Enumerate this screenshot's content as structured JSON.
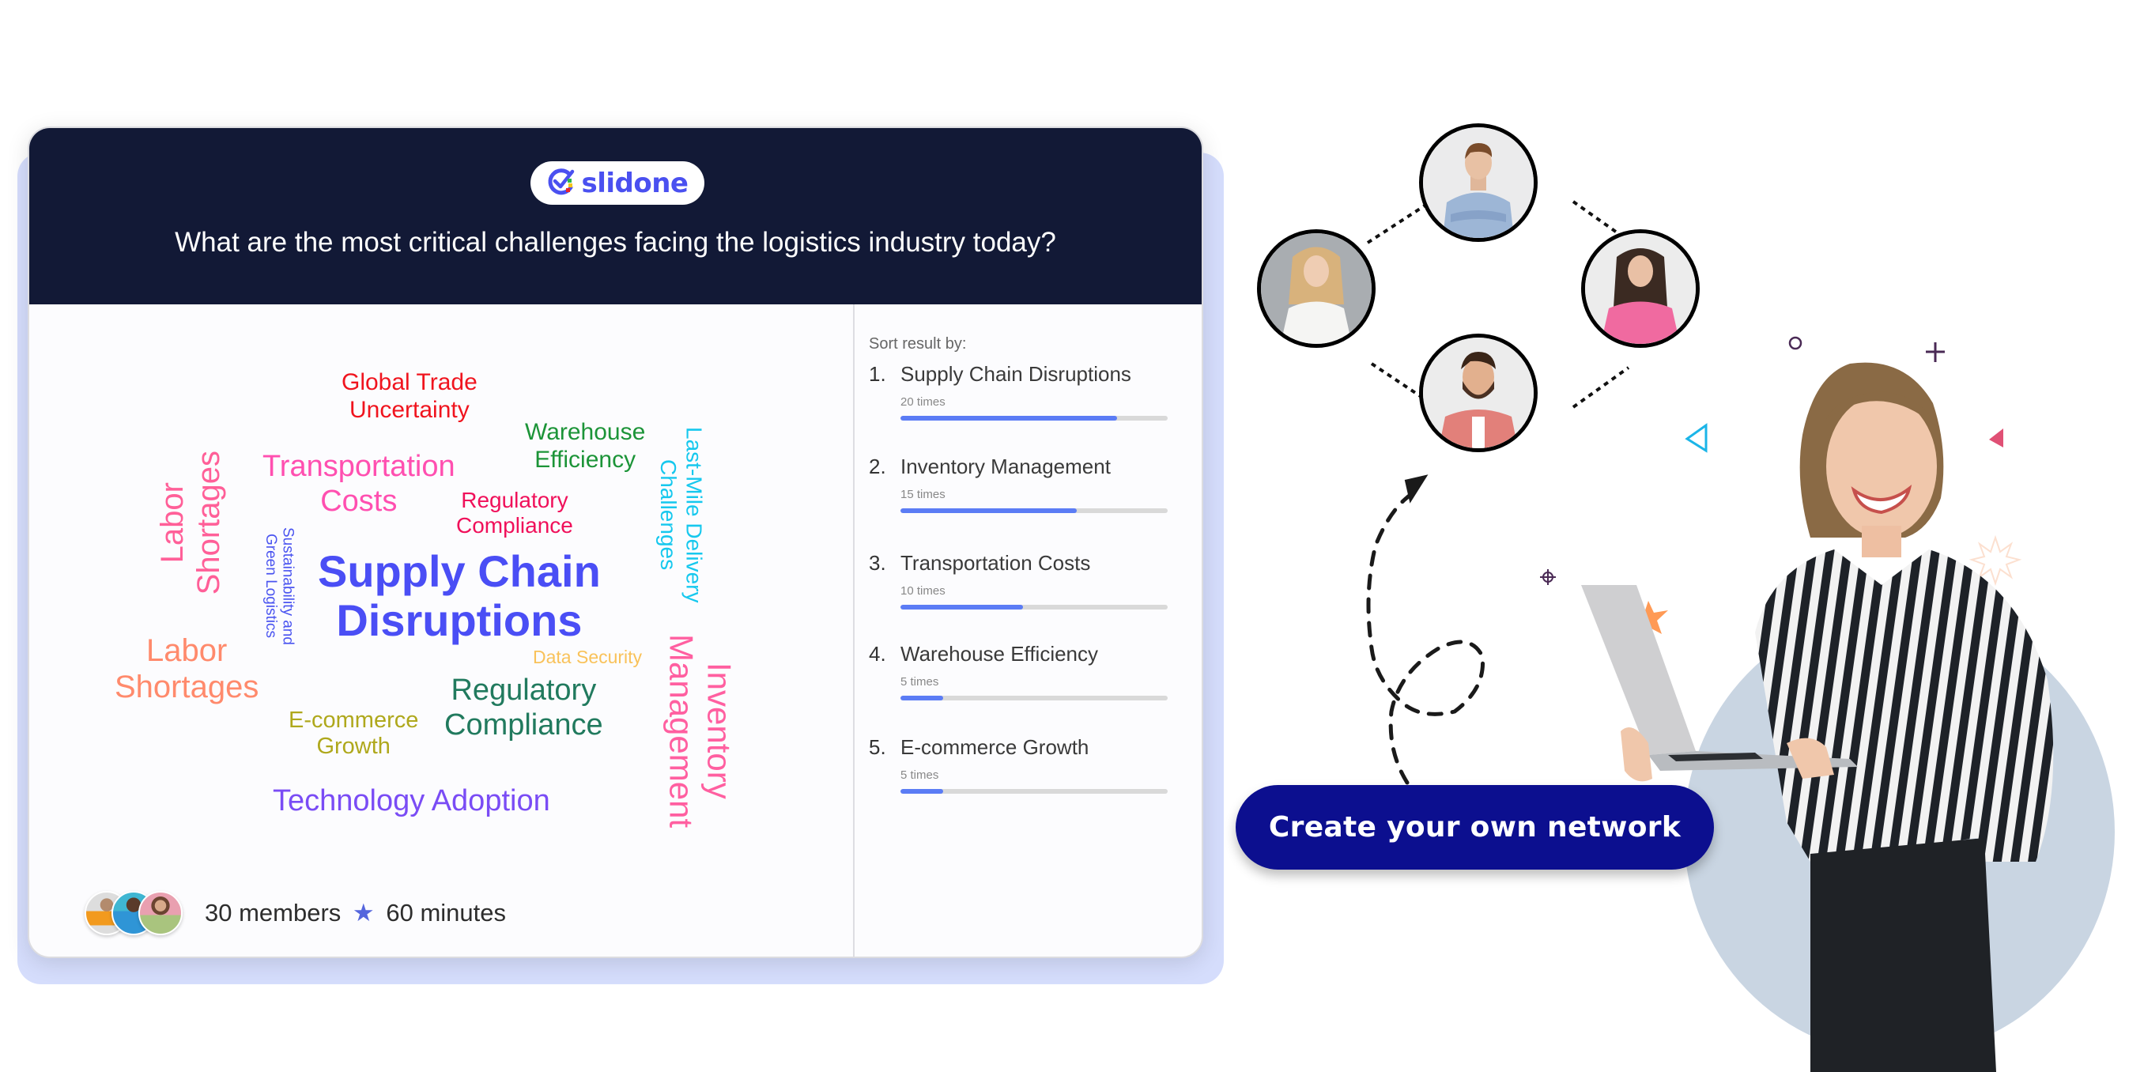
{
  "card": {
    "logo_text": "slidone",
    "question": "What are the most critical challenges facing the logistics industry today?"
  },
  "word_cloud": {
    "words": [
      {
        "text": "Global Trade Uncertainty",
        "line1": "Global Trade",
        "line2": "Uncertainty",
        "color": "#F0141E"
      },
      {
        "text": "Warehouse Efficiency",
        "line1": "Warehouse",
        "line2": "Efficiency",
        "color": "#1C9438"
      },
      {
        "text": "Transportation Costs",
        "line1": "Transportation",
        "line2": "Costs",
        "color": "#FF4FB0"
      },
      {
        "text": "Regulatory Compliance",
        "line1": "Regulatory",
        "line2": "Compliance",
        "color": "#F0105A"
      },
      {
        "text": "Last-Mile Delivery Challenges",
        "line1": "Last-Mile Delivery",
        "line2": "Challenges",
        "color": "#16C8EE"
      },
      {
        "text": "Labor Shortages",
        "line1": "Labor",
        "line2": "Shortages",
        "color": "#FF5F98"
      },
      {
        "text": "Sustainability and Green Logistics",
        "line1": "Sustainability and",
        "line2": "Green Logistics",
        "color": "#4A54F0"
      },
      {
        "text": "Supply Chain Disruptions",
        "line1": "Supply Chain",
        "line2": "Disruptions",
        "color": "#4A4EF5"
      },
      {
        "text": "Labor Shortages",
        "line1": "Labor",
        "line2": "Shortages",
        "color": "#FF8A6C"
      },
      {
        "text": "Data Security",
        "line1": "Data Security",
        "color": "#F9C25A"
      },
      {
        "text": "Regulatory Compliance",
        "line1": "Regulatory",
        "line2": "Compliance",
        "color": "#217A5E"
      },
      {
        "text": "E-commerce Growth",
        "line1": "E-commerce",
        "line2": "Growth",
        "color": "#AFA81C"
      },
      {
        "text": "Inventory Management",
        "line1": "Inventory",
        "line2": "Management",
        "color": "#FF5FA0"
      },
      {
        "text": "Technology Adoption",
        "line1": "Technology Adoption",
        "color": "#7A4CF5"
      }
    ]
  },
  "results": {
    "sort_label": "Sort result by:",
    "items": [
      {
        "rank": "1.",
        "label": "Supply Chain Disruptions",
        "count": "20 times",
        "progress": 0.81
      },
      {
        "rank": "2.",
        "label": "Inventory Management",
        "count": "15 times",
        "progress": 0.66
      },
      {
        "rank": "3.",
        "label": "Transportation Costs",
        "count": "10 times",
        "progress": 0.46
      },
      {
        "rank": "4.",
        "label": "Warehouse Efficiency",
        "count": "5 times",
        "progress": 0.16
      },
      {
        "rank": "5.",
        "label": "E-commerce Growth",
        "count": "5 times",
        "progress": 0.16
      }
    ]
  },
  "footer": {
    "members": "30 members",
    "separator_icon": "★",
    "duration": "60 minutes"
  },
  "network": {
    "people": [
      "man-blue-shirt",
      "woman-blonde-white-shirt",
      "woman-pink-sweater",
      "man-beard-plaid-shirt"
    ]
  },
  "cta": {
    "label": "Create your own network"
  },
  "colors": {
    "header_bg": "#121936",
    "brand_blue": "#4A50F0",
    "cta_bg": "#0C0F8F",
    "progress_fill": "#5B7CF5",
    "backing": "#D5DDFC"
  }
}
